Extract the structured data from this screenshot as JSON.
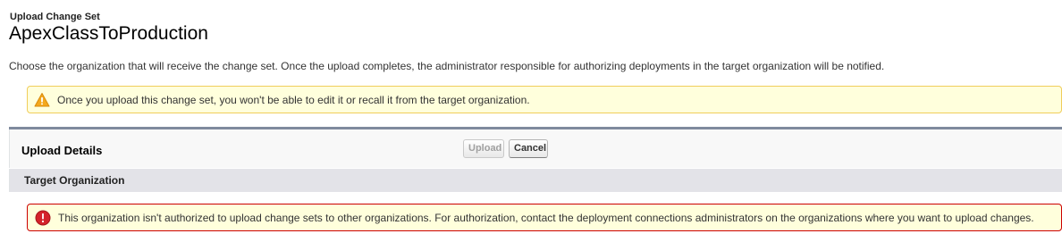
{
  "page": {
    "subtitle": "Upload Change Set",
    "title": "ApexClassToProduction",
    "description": "Choose the organization that will receive the change set. Once the upload completes, the administrator responsible for authorizing deployments in the target organization will be notified."
  },
  "warning": {
    "icon": "warning-icon",
    "text": "Once you upload this change set, you won't be able to edit it or recall it from the target organization.",
    "color": "#f0cd5b"
  },
  "upload_details": {
    "title": "Upload Details",
    "upload_label": "Upload",
    "cancel_label": "Cancel",
    "upload_disabled": true
  },
  "target_org": {
    "section_title": "Target Organization"
  },
  "error": {
    "icon": "error-icon",
    "text": "This organization isn't authorized to upload change sets to other organizations. For authorization, contact the deployment connections administrators on the organizations where you want to upload changes.",
    "color": "#cc0000"
  }
}
